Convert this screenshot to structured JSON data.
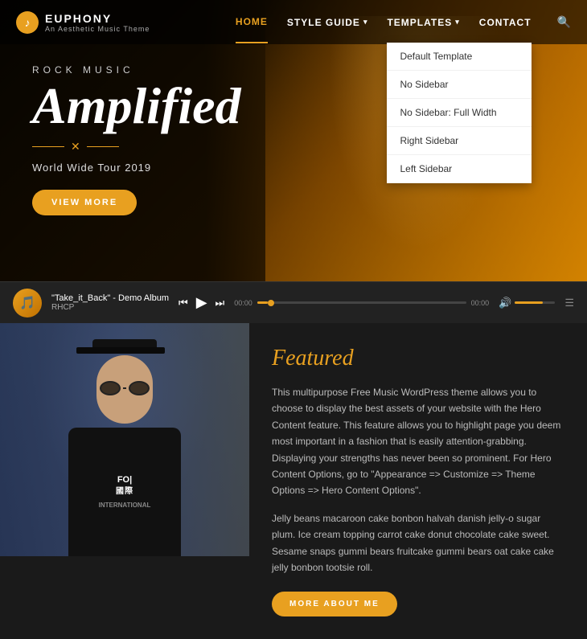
{
  "brand": {
    "logo_icon": "♪",
    "title": "EUPHONY",
    "subtitle": "An Aesthetic Music Theme"
  },
  "nav": {
    "links": [
      {
        "id": "home",
        "label": "HOME",
        "active": true,
        "has_dropdown": false
      },
      {
        "id": "style-guide",
        "label": "STYLE GUIDE",
        "active": false,
        "has_dropdown": true
      },
      {
        "id": "templates",
        "label": "TEMPLATES",
        "active": false,
        "has_dropdown": true
      },
      {
        "id": "contact",
        "label": "CONTACT",
        "active": false,
        "has_dropdown": false
      }
    ],
    "templates_dropdown": [
      {
        "label": "Default Template"
      },
      {
        "label": "No Sidebar"
      },
      {
        "label": "No Sidebar: Full Width"
      },
      {
        "label": "Right Sidebar"
      },
      {
        "label": "Left Sidebar"
      }
    ]
  },
  "hero": {
    "subtitle": "ROCK MUSIC",
    "title": "Amplified",
    "tour_text": "World Wide Tour 2019",
    "cta_label": "VIEW MORE",
    "divider_icon": "✕"
  },
  "player": {
    "track_name": "\"Take_it_Back\" - Demo Album",
    "artist": "RHCP",
    "time_elapsed": "00:00",
    "time_total": "00:00",
    "progress_pct": 5
  },
  "featured": {
    "title": "Featured",
    "paragraph1": "This multipurpose Free Music WordPress theme allows you to choose to display the best assets of your website with the Hero Content feature. This feature allows you to highlight page you deem most important in a fashion that is easily attention-grabbing. Displaying your strengths has never been so prominent. For Hero Content Options, go to \"Appearance => Customize => Theme Options => Hero Content Options\".",
    "paragraph2": "Jelly beans macaroon cake bonbon halvah danish jelly-o sugar plum. Ice cream topping carrot cake donut chocolate cake sweet. Sesame snaps gummi bears fruitcake gummi bears oat cake cake jelly bonbon tootsie roll.",
    "cta_label": "MORE ABOUT ME"
  }
}
